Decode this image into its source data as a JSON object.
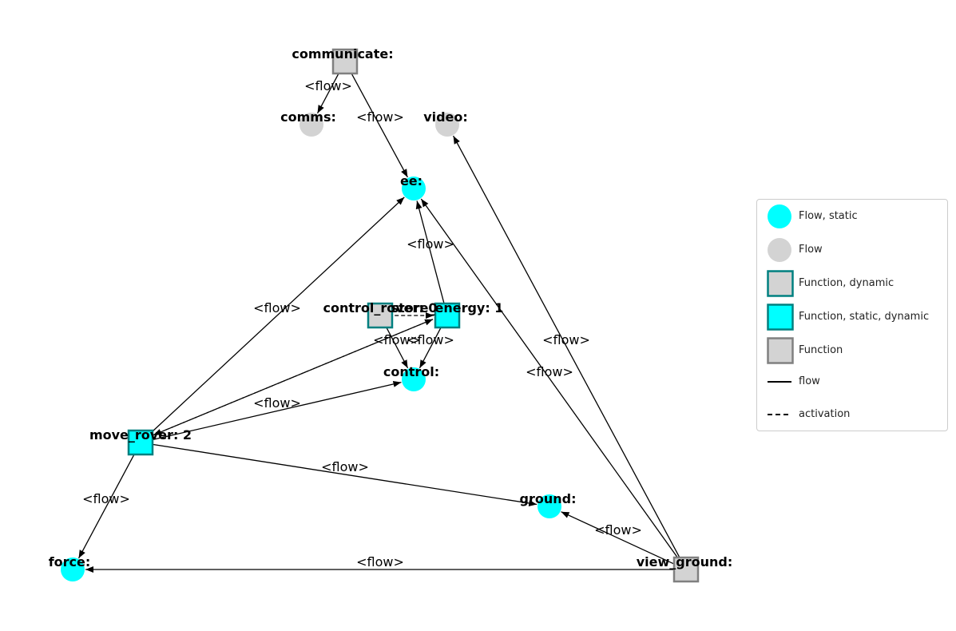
{
  "diagram": {
    "type": "directed-graph",
    "colors": {
      "flow_static": "#00ffff",
      "flow": "#d3d3d3",
      "function_fill": "#d3d3d3",
      "function_static_fill": "#00ffff",
      "dynamic_border": "#008080",
      "function_border": "#808080",
      "edge": "#000000"
    },
    "nodes": [
      {
        "id": "communicate",
        "label": "communicate:",
        "kind": "function"
      },
      {
        "id": "comms",
        "label": "comms:",
        "kind": "flow"
      },
      {
        "id": "video",
        "label": "video:",
        "kind": "flow"
      },
      {
        "id": "ee",
        "label": "ee:",
        "kind": "flow_static"
      },
      {
        "id": "control_rover",
        "label": "control_rover: 0",
        "kind": "function_dynamic"
      },
      {
        "id": "store_energy",
        "label": "store_energy: 1",
        "kind": "function_static_dynamic"
      },
      {
        "id": "control",
        "label": "control:",
        "kind": "flow_static"
      },
      {
        "id": "move_rover",
        "label": "move_rover: 2",
        "kind": "function_static_dynamic"
      },
      {
        "id": "ground",
        "label": "ground:",
        "kind": "flow_static"
      },
      {
        "id": "force",
        "label": "force:",
        "kind": "flow_static"
      },
      {
        "id": "view_ground",
        "label": "view_ground:",
        "kind": "function"
      }
    ],
    "edges": [
      {
        "from": "communicate",
        "to": "comms",
        "label": "<flow>",
        "style": "flow"
      },
      {
        "from": "communicate",
        "to": "ee",
        "label": "<flow>",
        "style": "flow"
      },
      {
        "from": "store_energy",
        "to": "ee",
        "label": "<flow>",
        "style": "flow"
      },
      {
        "from": "move_rover",
        "to": "ee",
        "label": "<flow>",
        "style": "flow"
      },
      {
        "from": "view_ground",
        "to": "ee",
        "label": "<flow>",
        "style": "flow"
      },
      {
        "from": "view_ground",
        "to": "video",
        "label": "<flow>",
        "style": "flow"
      },
      {
        "from": "control_rover",
        "to": "control",
        "label": "<flow>",
        "style": "flow"
      },
      {
        "from": "store_energy",
        "to": "control",
        "label": "<flow>",
        "style": "flow"
      },
      {
        "from": "move_rover",
        "to": "control",
        "label": "<flow>",
        "style": "flow"
      },
      {
        "from": "move_rover",
        "to": "ground",
        "label": "<flow>",
        "style": "flow"
      },
      {
        "from": "move_rover",
        "to": "force",
        "label": "<flow>",
        "style": "flow"
      },
      {
        "from": "view_ground",
        "to": "ground",
        "label": "<flow>",
        "style": "flow"
      },
      {
        "from": "view_ground",
        "to": "force",
        "label": "<flow>",
        "style": "flow"
      },
      {
        "from": "control_rover",
        "to": "store_energy",
        "label": "",
        "style": "activation"
      },
      {
        "from": "move_rover",
        "to": "store_energy",
        "label": "",
        "style": "activation"
      },
      {
        "from": "store_energy",
        "to": "move_rover",
        "label": "",
        "style": "activation"
      }
    ]
  },
  "legend": {
    "items": [
      {
        "symbol": "flow_static",
        "label": "Flow, static"
      },
      {
        "symbol": "flow",
        "label": "Flow"
      },
      {
        "symbol": "function_dynamic",
        "label": "Function, dynamic"
      },
      {
        "symbol": "function_static_dynamic",
        "label": "Function, static, dynamic"
      },
      {
        "symbol": "function",
        "label": "Function"
      },
      {
        "symbol": "line_solid",
        "label": "flow"
      },
      {
        "symbol": "line_dashed",
        "label": "activation"
      }
    ]
  }
}
